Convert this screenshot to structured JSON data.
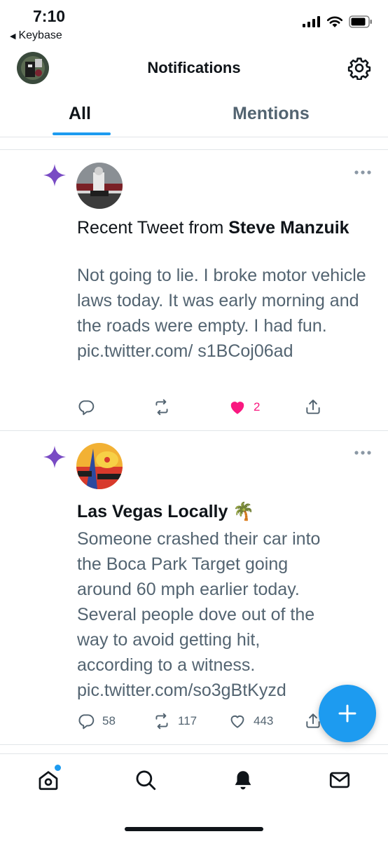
{
  "status_bar": {
    "time": "7:10",
    "back_app": "Keybase"
  },
  "header": {
    "title": "Notifications"
  },
  "tabs": [
    {
      "label": "All",
      "active": true
    },
    {
      "label": "Mentions",
      "active": false
    }
  ],
  "notifications": [
    {
      "heading_prefix": "Recent Tweet from ",
      "heading_name": "Steve Manzuik",
      "body": "Not going to lie. I broke motor vehicle laws today. It was early morning and the roads were empty. I had fun. pic.twitter.com/ s1BCoj06ad",
      "replies": "",
      "retweets": "",
      "likes": "2",
      "liked": true
    },
    {
      "heading_name": "Las Vegas Locally 🌴",
      "body": "Someone crashed their car into the Boca Park Target going around 60 mph earlier today. Several people dove out of the way to avoid getting hit, according to a witness. pic.twitter.com/so3gBtKyzd",
      "replies": "58",
      "retweets": "117",
      "likes": "443",
      "liked": false
    }
  ],
  "colors": {
    "accent": "#1d9bf0",
    "star": "#794bc4",
    "like": "#f91880",
    "muted": "#536471"
  },
  "bottom_nav": [
    "home-icon",
    "search-icon",
    "notifications-bell-icon",
    "messages-icon"
  ]
}
